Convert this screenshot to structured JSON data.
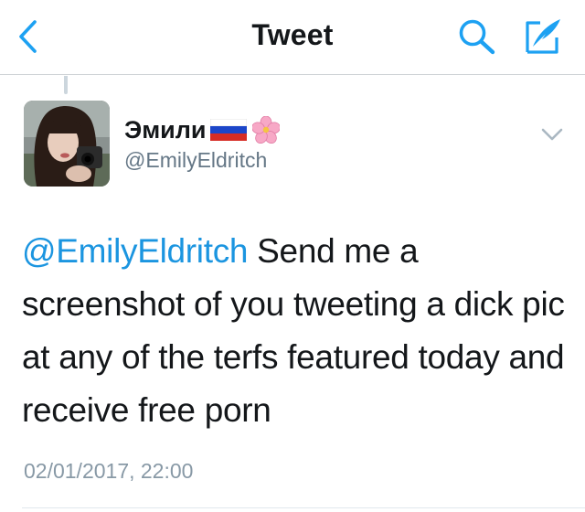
{
  "navbar": {
    "title": "Tweet",
    "back_icon": "chevron-left-icon",
    "search_icon": "search-icon",
    "compose_icon": "compose-tweet-icon",
    "accent_color": "#1da1f2"
  },
  "tweet": {
    "author": {
      "display_name": "Эмили",
      "flag_icon": "russia-flag-icon",
      "blossom_icon": "cherry-blossom-icon",
      "username": "@EmilyEldritch"
    },
    "text": {
      "mention": "@EmilyEldritch",
      "body": " Send me a screenshot of you tweeting a dick pic at any of the terfs featured today and receive free porn"
    },
    "timestamp": "02/01/2017, 22:00",
    "mention_color": "#1b95e0"
  }
}
